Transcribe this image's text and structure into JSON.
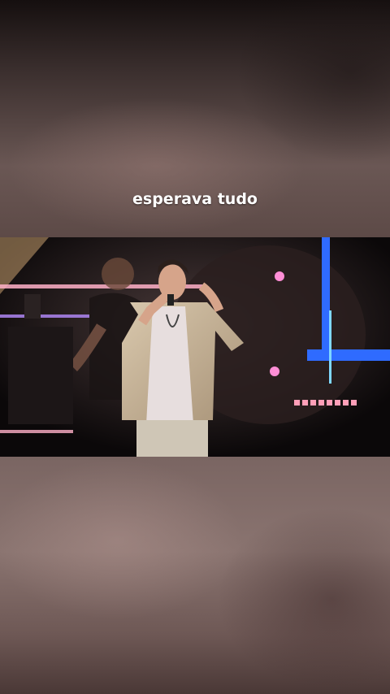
{
  "caption": "esperava tudo",
  "colors": {
    "stage_blue": "#2f6bff",
    "stage_pink": "#ff6fa0",
    "jacket": "#c9b59a"
  },
  "icons": [
    "stage-light"
  ]
}
